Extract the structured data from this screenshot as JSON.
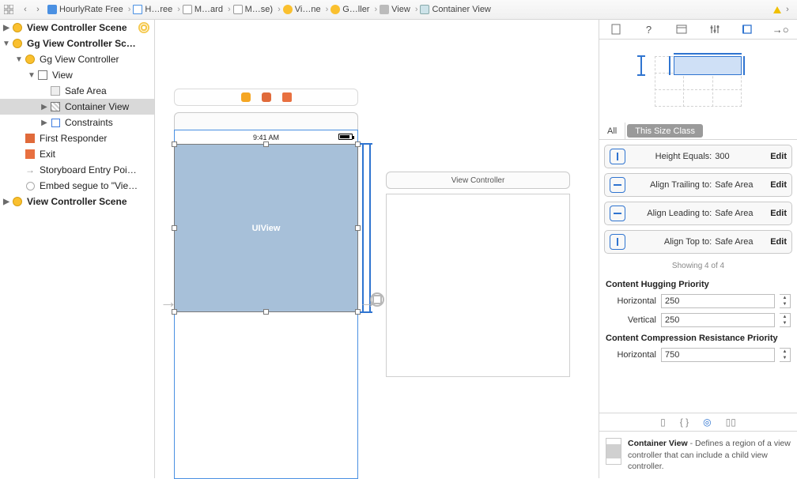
{
  "breadcrumb": {
    "items": [
      {
        "icon": "blue",
        "label": "HourlyRate Free"
      },
      {
        "icon": "folder",
        "label": "H…ree"
      },
      {
        "icon": "storyboard",
        "label": "M…ard"
      },
      {
        "icon": "storyboard",
        "label": "M…se)"
      },
      {
        "icon": "yellow",
        "label": "Vi…ne"
      },
      {
        "icon": "yellow",
        "label": "G…ller"
      },
      {
        "icon": "gray",
        "label": "View"
      },
      {
        "icon": "teal",
        "label": "Container View"
      }
    ]
  },
  "outline": {
    "r0": "View Controller Scene",
    "r1": "Gg View Controller Sc…",
    "r2": "Gg View Controller",
    "r3": "View",
    "r4": "Safe Area",
    "r5": "Container View",
    "r6": "Constraints",
    "r7": "First Responder",
    "r8": "Exit",
    "r9": "Storyboard Entry Poi…",
    "r10": "Embed segue to \"Vie…",
    "r11": "View Controller Scene"
  },
  "canvas": {
    "time": "9:41 AM",
    "uiview_label": "UIView",
    "vc2_title": "View Controller"
  },
  "inspector": {
    "seg_all": "All",
    "seg_this": "This Size Class",
    "constraints": [
      {
        "label": "Height Equals:",
        "value": "300",
        "edit": "Edit"
      },
      {
        "label": "Align Trailing to:",
        "value": "Safe Area",
        "edit": "Edit"
      },
      {
        "label": "Align Leading to:",
        "value": "Safe Area",
        "edit": "Edit"
      },
      {
        "label": "Align Top to:",
        "value": "Safe Area",
        "edit": "Edit"
      }
    ],
    "showing": "Showing 4 of 4",
    "hugging_title": "Content Hugging Priority",
    "hugging_h_label": "Horizontal",
    "hugging_h": "250",
    "hugging_v_label": "Vertical",
    "hugging_v": "250",
    "compress_title": "Content Compression Resistance Priority",
    "compress_h_label": "Horizontal",
    "compress_h": "750",
    "obj_name": "Container View",
    "obj_desc": " - Defines a region of a view controller that can include a child view controller."
  }
}
